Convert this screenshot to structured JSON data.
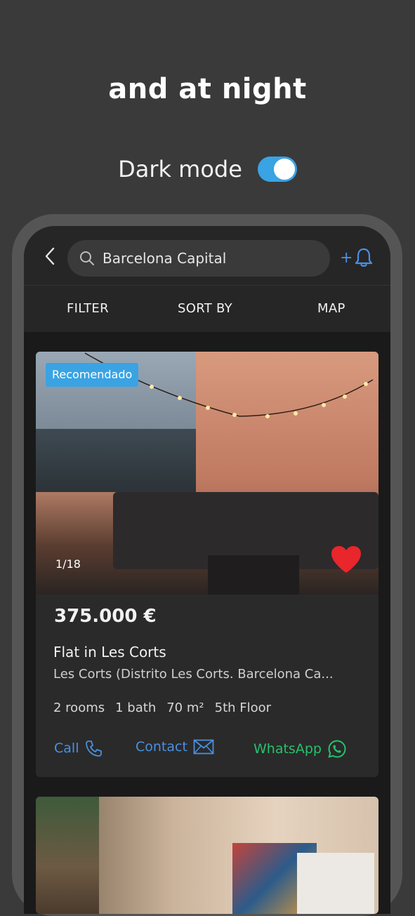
{
  "hero": {
    "headline": "and at night",
    "mode_label": "Dark mode",
    "toggle_on": true
  },
  "search": {
    "value": "Barcelona Capital",
    "alert_plus": "+"
  },
  "tabs": {
    "filter": "FILTER",
    "sort": "SORT BY",
    "map": "MAP"
  },
  "listing": {
    "badge": "Recomendado",
    "photo_counter": "1/18",
    "price": "375.000 €",
    "title": "Flat in Les Corts",
    "location": "Les Corts (Distrito Les Corts. Barcelona Ca...",
    "features": {
      "rooms": "2 rooms",
      "bath": "1 bath",
      "area": "70 m²",
      "floor": "5th Floor"
    },
    "actions": {
      "call": "Call",
      "contact": "Contact",
      "whatsapp": "WhatsApp"
    }
  },
  "colors": {
    "accent_blue": "#3aa3e3",
    "link_blue": "#4a90e2",
    "whatsapp_green": "#25c26b",
    "favorite_red": "#e8262b"
  },
  "icons": {
    "back": "chevron-left-icon",
    "search": "search-icon",
    "alert": "bell-icon",
    "favorite": "heart-icon",
    "call": "phone-icon",
    "contact": "envelope-icon",
    "whatsapp": "whatsapp-icon"
  }
}
